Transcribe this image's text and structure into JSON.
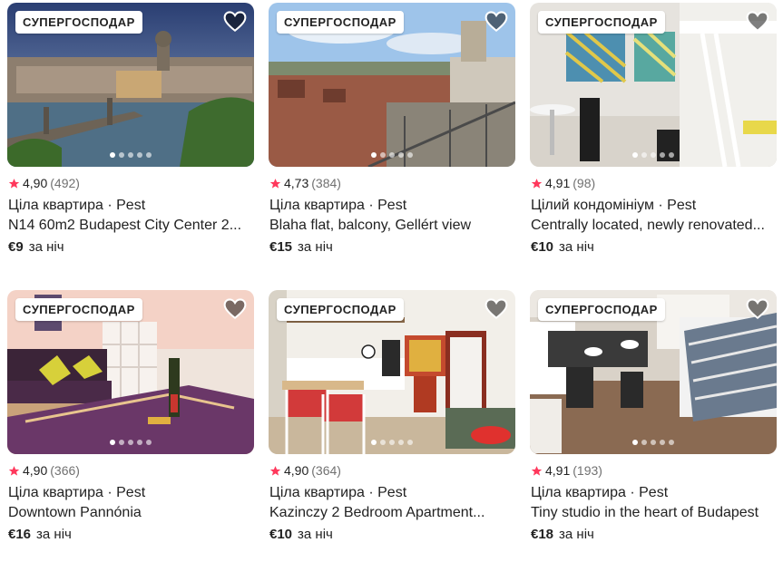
{
  "listings": [
    {
      "badge": "СУПЕРГОСПОДАР",
      "rating": "4,90",
      "reviews": "(492)",
      "type": "Ціла квартира · Pest",
      "title": "N14 60m2 Budapest City Center 2...",
      "price": "€9",
      "price_unit": "за ніч"
    },
    {
      "badge": "СУПЕРГОСПОДАР",
      "rating": "4,73",
      "reviews": "(384)",
      "type": "Ціла квартира · Pest",
      "title": "Blaha flat, balcony, Gellért view",
      "price": "€15",
      "price_unit": "за ніч"
    },
    {
      "badge": "СУПЕРГОСПОДАР",
      "rating": "4,91",
      "reviews": "(98)",
      "type": "Цілий кондомініум · Pest",
      "title": "Centrally located, newly renovated...",
      "price": "€10",
      "price_unit": "за ніч"
    },
    {
      "badge": "СУПЕРГОСПОДАР",
      "rating": "4,90",
      "reviews": "(366)",
      "type": "Ціла квартира · Pest",
      "title": "Downtown Pannónia",
      "price": "€16",
      "price_unit": "за ніч"
    },
    {
      "badge": "СУПЕРГОСПОДАР",
      "rating": "4,90",
      "reviews": "(364)",
      "type": "Ціла квартира · Pest",
      "title": "Kazinczy 2 Bedroom Apartment...",
      "price": "€10",
      "price_unit": "за ніч"
    },
    {
      "badge": "СУПЕРГОСПОДАР",
      "rating": "4,91",
      "reviews": "(193)",
      "type": "Ціла квартира · Pest",
      "title": "Tiny studio in the heart of Budapest",
      "price": "€18",
      "price_unit": "за ніч"
    }
  ],
  "icons": {
    "star": "star-icon",
    "heart": "heart-icon"
  },
  "colors": {
    "star": "#FF385C",
    "muted": "#717171",
    "text": "#222222"
  }
}
